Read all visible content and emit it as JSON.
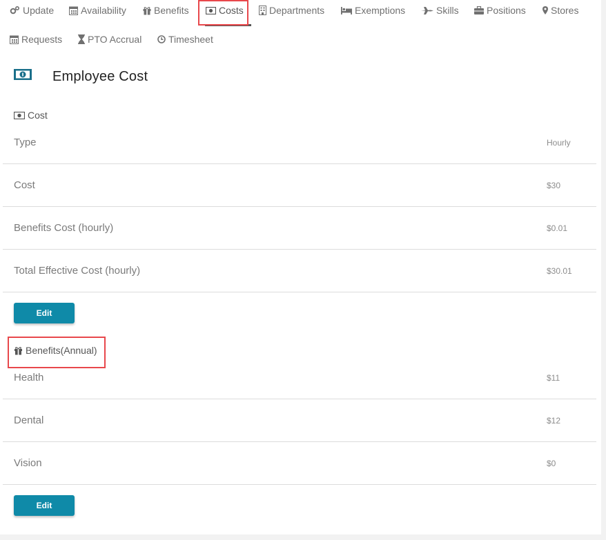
{
  "nav": {
    "tabs": [
      {
        "label": "Update",
        "icon": "gears-icon"
      },
      {
        "label": "Availability",
        "icon": "calendar-icon"
      },
      {
        "label": "Benefits",
        "icon": "gift-icon"
      },
      {
        "label": "Costs",
        "icon": "money-icon",
        "active": true
      },
      {
        "label": "Departments",
        "icon": "building-icon"
      },
      {
        "label": "Exemptions",
        "icon": "bed-icon"
      },
      {
        "label": "Skills",
        "icon": "plane-icon"
      },
      {
        "label": "Positions",
        "icon": "briefcase-icon"
      },
      {
        "label": "Stores",
        "icon": "map-marker-icon"
      },
      {
        "label": "Requests",
        "icon": "calendar-icon"
      },
      {
        "label": "PTO Accrual",
        "icon": "hourglass-icon"
      },
      {
        "label": "Timesheet",
        "icon": "clock-icon"
      }
    ]
  },
  "page": {
    "title": "Employee Cost"
  },
  "cost_section": {
    "heading": "Cost",
    "rows": [
      {
        "label": "Type",
        "value": "Hourly"
      },
      {
        "label": "Cost",
        "value": "$30"
      },
      {
        "label": "Benefits Cost (hourly)",
        "value": "$0.01"
      },
      {
        "label": "Total Effective Cost (hourly)",
        "value": "$30.01"
      }
    ],
    "edit_label": "Edit"
  },
  "benefits_section": {
    "heading": "Benefits(Annual)",
    "rows": [
      {
        "label": "Health",
        "value": "$11"
      },
      {
        "label": "Dental",
        "value": "$12"
      },
      {
        "label": "Vision",
        "value": "$0"
      }
    ],
    "edit_label": "Edit"
  },
  "colors": {
    "accent": "#0f8aa8",
    "highlight": "#e8474b",
    "money_icon": "#1a6f8a"
  }
}
